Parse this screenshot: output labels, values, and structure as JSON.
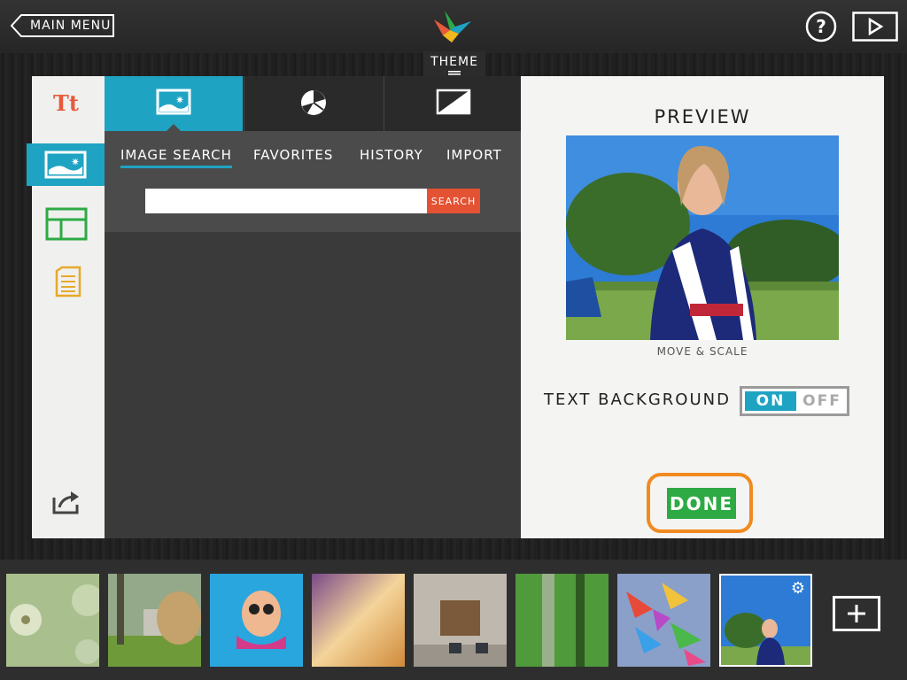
{
  "topbar": {
    "main_menu_label": "MAIN MENU",
    "help_icon": "question-circle-icon",
    "play_icon": "play-icon",
    "logo_icon": "origami-bird-logo"
  },
  "theme_tab": {
    "label": "THEME"
  },
  "sidebar": {
    "items": [
      {
        "icon": "text-tt-icon",
        "glyph": "Tt"
      },
      {
        "icon": "image-icon"
      },
      {
        "icon": "layout-icon"
      },
      {
        "icon": "document-icon"
      },
      {
        "icon": "share-icon"
      }
    ]
  },
  "tabs": [
    {
      "icon": "image-icon"
    },
    {
      "icon": "color-palette-icon"
    },
    {
      "icon": "contrast-icon"
    }
  ],
  "subtabs": [
    "IMAGE SEARCH",
    "FAVORITES",
    "HISTORY",
    "IMPORT"
  ],
  "search": {
    "placeholder": "",
    "button_label": "SEARCH"
  },
  "preview": {
    "title": "PREVIEW",
    "caption": "MOVE & SCALE",
    "text_background_label": "TEXT BACKGROUND",
    "toggle_on": "ON",
    "toggle_off": "OFF",
    "toggle_state": "on",
    "done_label": "DONE"
  },
  "filmstrip": {
    "thumbnails": [
      "dandelion-seeds",
      "garden-trees",
      "child-swimming",
      "golden-fabric",
      "child-sitting",
      "green-trees-blur",
      "paper-cranes",
      "girl-soccer-uniform"
    ],
    "selected_index": 7,
    "add_icon": "plus-icon"
  },
  "colors": {
    "accent": "#1fa3c3",
    "search_button": "#e35233",
    "done_button": "#2eaa45",
    "done_highlight": "#f08a1f"
  }
}
